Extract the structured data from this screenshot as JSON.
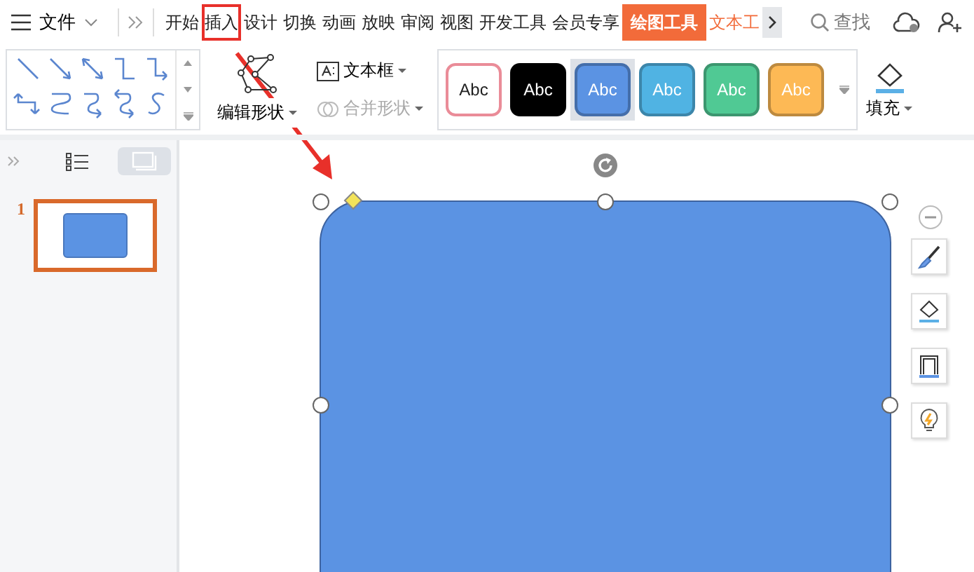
{
  "menu": {
    "file_label": "文件"
  },
  "tabs": [
    {
      "label": "开始",
      "selected": false,
      "highlighted": false
    },
    {
      "label": "插入",
      "selected": false,
      "highlighted": true
    },
    {
      "label": "设计",
      "selected": false,
      "highlighted": false
    },
    {
      "label": "切换",
      "selected": false,
      "highlighted": false
    },
    {
      "label": "动画",
      "selected": false,
      "highlighted": false
    },
    {
      "label": "放映",
      "selected": false,
      "highlighted": false
    },
    {
      "label": "审阅",
      "selected": false,
      "highlighted": false
    },
    {
      "label": "视图",
      "selected": false,
      "highlighted": false
    },
    {
      "label": "开发工具",
      "selected": false,
      "highlighted": false
    },
    {
      "label": "会员专享",
      "selected": false,
      "highlighted": false
    },
    {
      "label": "绘图工具",
      "selected": true,
      "highlighted": false
    },
    {
      "label": "文本工",
      "selected": false,
      "highlighted": false,
      "kind": "context"
    }
  ],
  "search": {
    "label": "查找"
  },
  "ribbon": {
    "edit_shape": "编辑形状",
    "text_box": "文本框",
    "merge_shape": {
      "label": "合并形状",
      "disabled": true
    },
    "fill": "填充",
    "styles": [
      {
        "label": "Abc",
        "color": "#ffffff",
        "selected": false
      },
      {
        "label": "Abc",
        "color": "#000000",
        "selected": false
      },
      {
        "label": "Abc",
        "color": "#5b93e3",
        "selected": true
      },
      {
        "label": "Abc",
        "color": "#50b3e3",
        "selected": false
      },
      {
        "label": "Abc",
        "color": "#50c994",
        "selected": false
      },
      {
        "label": "Abc",
        "color": "#fdb955",
        "selected": false
      }
    ]
  },
  "slides": [
    {
      "number": "1",
      "selected": true
    }
  ]
}
